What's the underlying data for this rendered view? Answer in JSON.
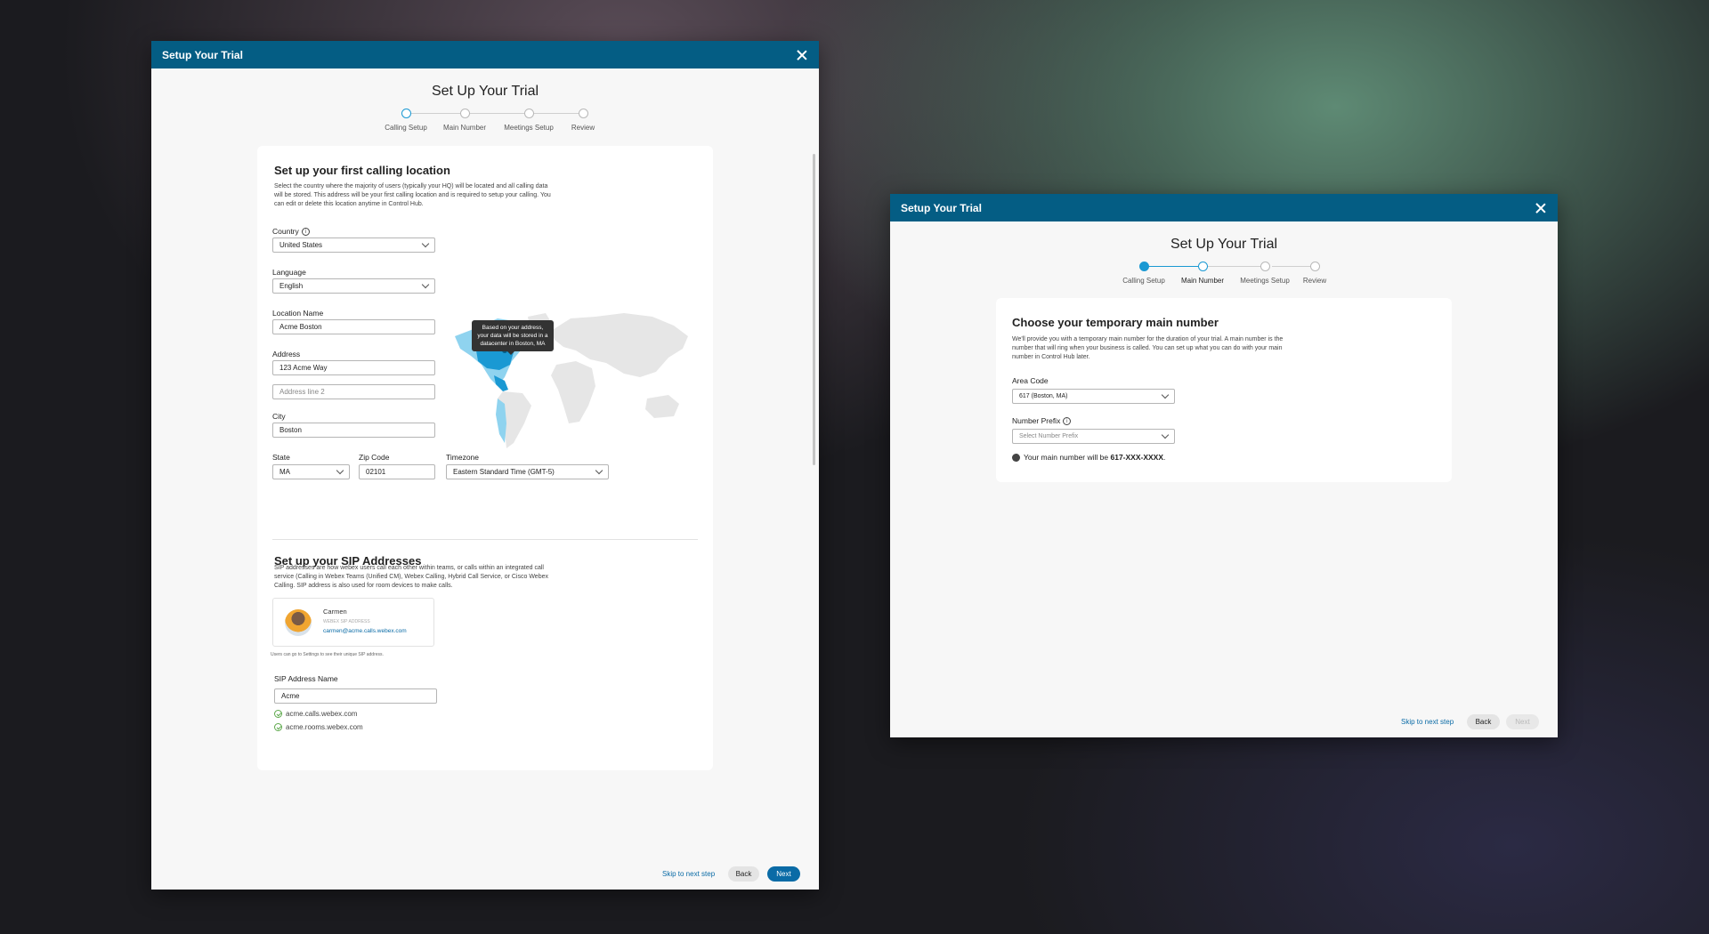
{
  "left": {
    "window_title": "Setup Your Trial",
    "heading": "Set Up Your Trial",
    "steps": [
      {
        "label": "Calling Setup",
        "state": "current"
      },
      {
        "label": "Main Number",
        "state": "pending"
      },
      {
        "label": "Meetings Setup",
        "state": "pending"
      },
      {
        "label": "Review",
        "state": "pending"
      }
    ],
    "location": {
      "title": "Set up your first calling location",
      "description": "Select the country where the majority of users (typically your HQ) will be located and all calling data will be stored. This address will be your first calling location and is required to setup your calling. You can edit or delete this location anytime in Control Hub.",
      "country_label": "Country",
      "country_value": "United States",
      "language_label": "Language",
      "language_value": "English",
      "location_name_label": "Location Name",
      "location_name_value": "Acme Boston",
      "address_label": "Address",
      "address_value": "123 Acme Way",
      "address2_placeholder": "Address line 2",
      "city_label": "City",
      "city_value": "Boston",
      "state_label": "State",
      "state_value": "MA",
      "zip_label": "Zip Code",
      "zip_value": "02101",
      "timezone_label": "Timezone",
      "timezone_value": "Eastern Standard Time (GMT-5)",
      "map_tooltip": "Based on your address, your data will be stored in a datacenter in Boston, MA"
    },
    "sip": {
      "title": "Set up your SIP Addresses",
      "description": "SIP addresses are how webex users call each other within teams, or calls within an integrated call service (Calling in Webex Teams (Unified CM), Webex Calling, Hybrid Call Service, or Cisco Webex Calling. SIP address is also used for room devices to make calls.",
      "user_name": "Carmen",
      "user_sub": "WEBEX SIP ADDRESS",
      "user_address": "carmen@acme.calls.webex.com",
      "hint": "Users can go to Settings to see their unique SIP address.",
      "name_label": "SIP Address Name",
      "name_value": "Acme",
      "domains": [
        "acme.calls.webex.com",
        "acme.rooms.webex.com"
      ]
    },
    "footer": {
      "skip": "Skip to next step",
      "back": "Back",
      "next": "Next"
    }
  },
  "right": {
    "window_title": "Setup Your Trial",
    "heading": "Set Up Your Trial",
    "steps": [
      {
        "label": "Calling Setup",
        "state": "done"
      },
      {
        "label": "Main Number",
        "state": "current"
      },
      {
        "label": "Meetings Setup",
        "state": "pending"
      },
      {
        "label": "Review",
        "state": "pending"
      }
    ],
    "title": "Choose your temporary main number",
    "description": "We'll provide you with a temporary main number for the duration of your trial. A main number is the number that will ring when your business is called. You can set up what you can do with your main number in Control Hub later.",
    "area_code_label": "Area Code",
    "area_code_value": "617 (Boston, MA)",
    "prefix_label": "Number Prefix",
    "prefix_placeholder": "Select Number Prefix",
    "result_prefix": "Your main number will be ",
    "result_number": "617-XXX-XXXX",
    "result_suffix": ".",
    "footer": {
      "skip": "Skip to next step",
      "back": "Back",
      "next": "Next"
    }
  },
  "colors": {
    "header": "#045d84",
    "accent": "#1a99d3",
    "primary_button": "#0a6ba6"
  }
}
